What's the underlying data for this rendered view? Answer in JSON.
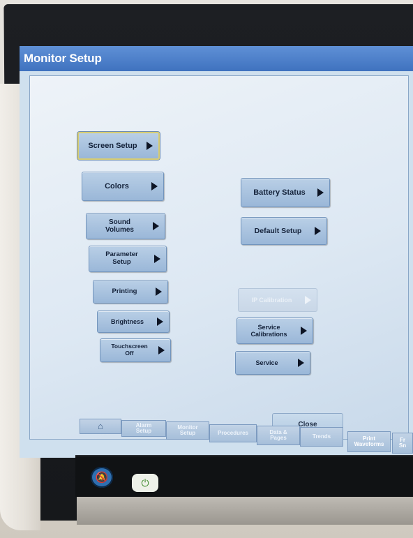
{
  "window": {
    "title": "Monitor Setup"
  },
  "left_menu": [
    {
      "label": "Screen Setup",
      "selected": true
    },
    {
      "label": "Colors"
    },
    {
      "label": "Sound\nVolumes"
    },
    {
      "label": "Parameter\nSetup"
    },
    {
      "label": "Printing"
    },
    {
      "label": "Brightness"
    },
    {
      "label": "Touchscreen\nOff"
    }
  ],
  "right_menu": [
    {
      "label": "Battery Status"
    },
    {
      "label": "Default Setup"
    },
    {
      "label": "IP Calibration",
      "disabled": true
    },
    {
      "label": "Service\nCalibrations"
    },
    {
      "label": "Service"
    }
  ],
  "close_label": "Close",
  "tabs": [
    {
      "label": "⌂",
      "icon": "home-icon"
    },
    {
      "label": "Alarm\nSetup"
    },
    {
      "label": "Monitor\nSetup"
    },
    {
      "label": "Procedures"
    },
    {
      "label": "Data &\nPages"
    },
    {
      "label": "Trends"
    },
    {
      "label": "Print\nWaveforms"
    },
    {
      "label": "Fr\nSn"
    }
  ],
  "hardware": {
    "alarm_icon": "alarm-silence-icon",
    "power_icon": "power-icon"
  }
}
